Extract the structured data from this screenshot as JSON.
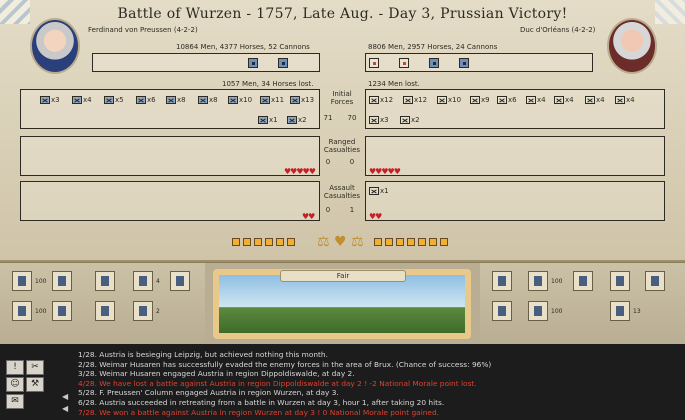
{
  "title": "Battle of Wurzen - 1757, Late Aug. - Day 3, Prussian Victory!",
  "left_side": {
    "general": "Ferdinand von Preussen (4-2-2)",
    "summary": "10864 Men, 4377 Horses, 52 Cannons",
    "lost": "1057 Men, 34 Horses lost.",
    "forces_count": "71",
    "ranged_count": "0",
    "assault_count": "0",
    "units": [
      {
        "type": "infantry",
        "count": "x3"
      },
      {
        "type": "infantry",
        "count": "x4"
      },
      {
        "type": "cavalry",
        "count": "x5"
      },
      {
        "type": "infantry",
        "count": "x6"
      },
      {
        "type": "cavalry",
        "count": "x8"
      },
      {
        "type": "infantry",
        "count": "x8"
      },
      {
        "type": "infantry",
        "count": "x10"
      },
      {
        "type": "infantry",
        "count": "x11"
      },
      {
        "type": "infantry",
        "count": "x13"
      },
      {
        "type": "artillery",
        "count": "x1"
      },
      {
        "type": "infantry",
        "count": "x2"
      }
    ]
  },
  "right_side": {
    "general": "Duc d'Orléans (4-2-2)",
    "summary": "8806 Men, 2957 Horses, 24 Cannons",
    "lost": "1234 Men lost.",
    "forces_count": "70",
    "ranged_count": "0",
    "assault_count": "1",
    "units": [
      {
        "type": "infantry",
        "count": "x12"
      },
      {
        "type": "infantry",
        "count": "x12"
      },
      {
        "type": "infantry",
        "count": "x10"
      },
      {
        "type": "infantry",
        "count": "x9"
      },
      {
        "type": "infantry",
        "count": "x6"
      },
      {
        "type": "cavalry",
        "count": "x4"
      },
      {
        "type": "infantry",
        "count": "x4"
      },
      {
        "type": "infantry",
        "count": "x4"
      },
      {
        "type": "cavalry",
        "count": "x4"
      },
      {
        "type": "infantry",
        "count": "x3"
      },
      {
        "type": "infantry",
        "count": "x2"
      }
    ],
    "assault_units": [
      {
        "type": "infantry",
        "count": "x1"
      }
    ]
  },
  "labels": {
    "initial_forces": "Initial Forces",
    "ranged_casualties": "Ranged Casualties",
    "assault_casualties": "Assault Casualties"
  },
  "weather": "Fair",
  "reserves": {
    "left": [
      "100",
      "4",
      "100",
      "2"
    ],
    "right": [
      "100",
      "100",
      "13"
    ]
  },
  "log": [
    {
      "text": "1/28.  Austria is besieging Leipzig, but achieved nothing this month.",
      "color": "#d8d8d8"
    },
    {
      "text": "2/28.  Weimar Husaren has successfully evaded the enemy forces in the area of Brux. (Chance of success: 96%)",
      "color": "#d8d8d8"
    },
    {
      "text": "3/28.  Weimar Husaren engaged Austria in region Dippoldiswalde, at day 2.",
      "color": "#d8d8d8"
    },
    {
      "text": "4/28.  We have lost a battle against Austria in region Dippoldiswalde at day 2 ! -2 National Morale point lost.",
      "color": "#e04030"
    },
    {
      "text": "5/28.  F. Preussen' Column engaged Austria in region Wurzen, at day 3.",
      "color": "#d8d8d8"
    },
    {
      "text": "6/28.  Austria succeeded in retreating from a battle in Wurzen at day 3, hour 1, after taking 20 hits.",
      "color": "#d8d8d8"
    },
    {
      "text": "7/28.  We won a battle against Austria in region Wurzen at day 3 ! 0 National Morale point gained.",
      "color": "#e04030"
    }
  ]
}
